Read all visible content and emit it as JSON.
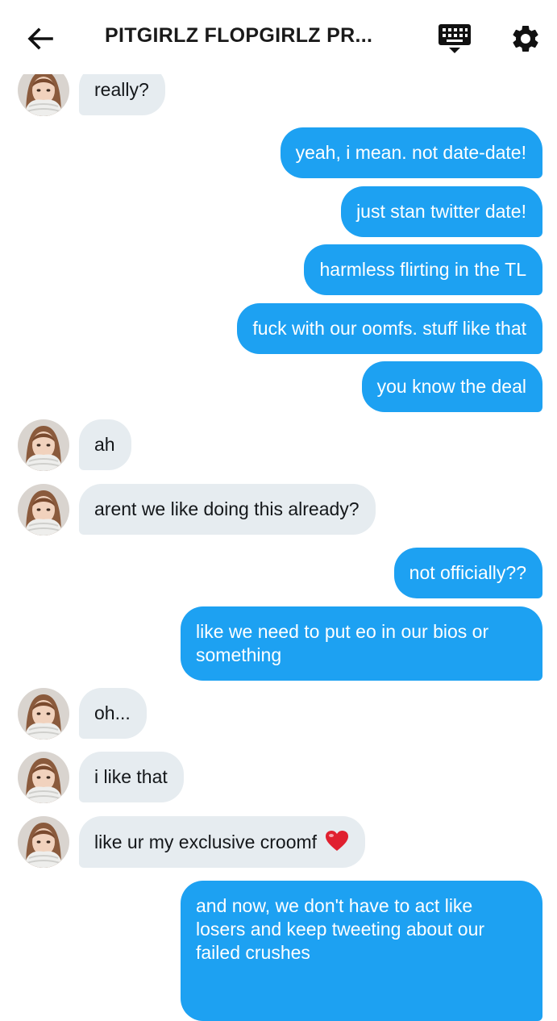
{
  "header": {
    "title": "PITGIRLZ FLOPGIRLZ PR...",
    "back_icon": "arrow-left-icon",
    "keyboard_icon": "keyboard-icon",
    "settings_icon": "gear-icon"
  },
  "colors": {
    "outgoing_bubble": "#1da1f2",
    "incoming_bubble": "#e6ecf0",
    "text_dark": "#14171a"
  },
  "messages": [
    {
      "from": "them",
      "text": "really?"
    },
    {
      "from": "me",
      "text": "yeah, i mean. not date-date!"
    },
    {
      "from": "me",
      "text": "just stan twitter date!"
    },
    {
      "from": "me",
      "text": "harmless flirting in the TL"
    },
    {
      "from": "me",
      "text": "fuck with our oomfs. stuff like that"
    },
    {
      "from": "me",
      "text": "you know the deal"
    },
    {
      "from": "them",
      "text": "ah"
    },
    {
      "from": "them",
      "text": "arent we like doing this already?"
    },
    {
      "from": "me",
      "text": "not officially??"
    },
    {
      "from": "me",
      "text": "like we need to put eo in our bios or something"
    },
    {
      "from": "them",
      "text": "oh..."
    },
    {
      "from": "them",
      "text": "i like that"
    },
    {
      "from": "them",
      "text": "like ur my exclusive croomf",
      "emoji": "red-heart-icon"
    },
    {
      "from": "me",
      "text": "and now, we don't have to act like losers and keep tweeting about our failed crushes"
    }
  ]
}
